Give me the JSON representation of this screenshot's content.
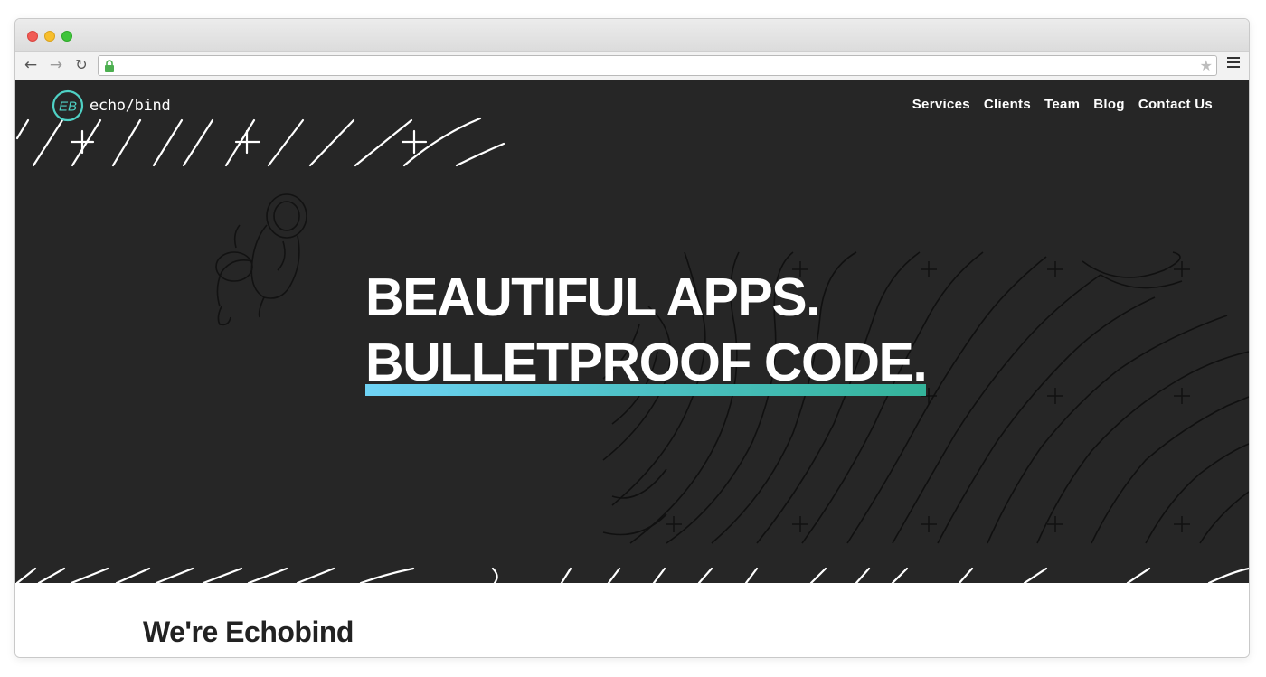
{
  "browser": {
    "url": "",
    "icons": [
      "back-arrow-icon",
      "forward-arrow-icon",
      "reload-icon",
      "lock-icon",
      "bookmark-star-icon",
      "menu-icon"
    ]
  },
  "site": {
    "logo_text": "echo/bind",
    "nav": [
      "Services",
      "Clients",
      "Team",
      "Blog",
      "Contact Us"
    ],
    "hero": {
      "line1": "BEAUTIFUL APPS.",
      "line2": "BULLETPROOF CODE."
    },
    "intro_heading": "We're Echobind"
  },
  "colors": {
    "hero_bg": "#262626",
    "accent_start": "#6fd3f5",
    "accent_end": "#34b39a",
    "logo_ring": "#4fd1c5"
  }
}
